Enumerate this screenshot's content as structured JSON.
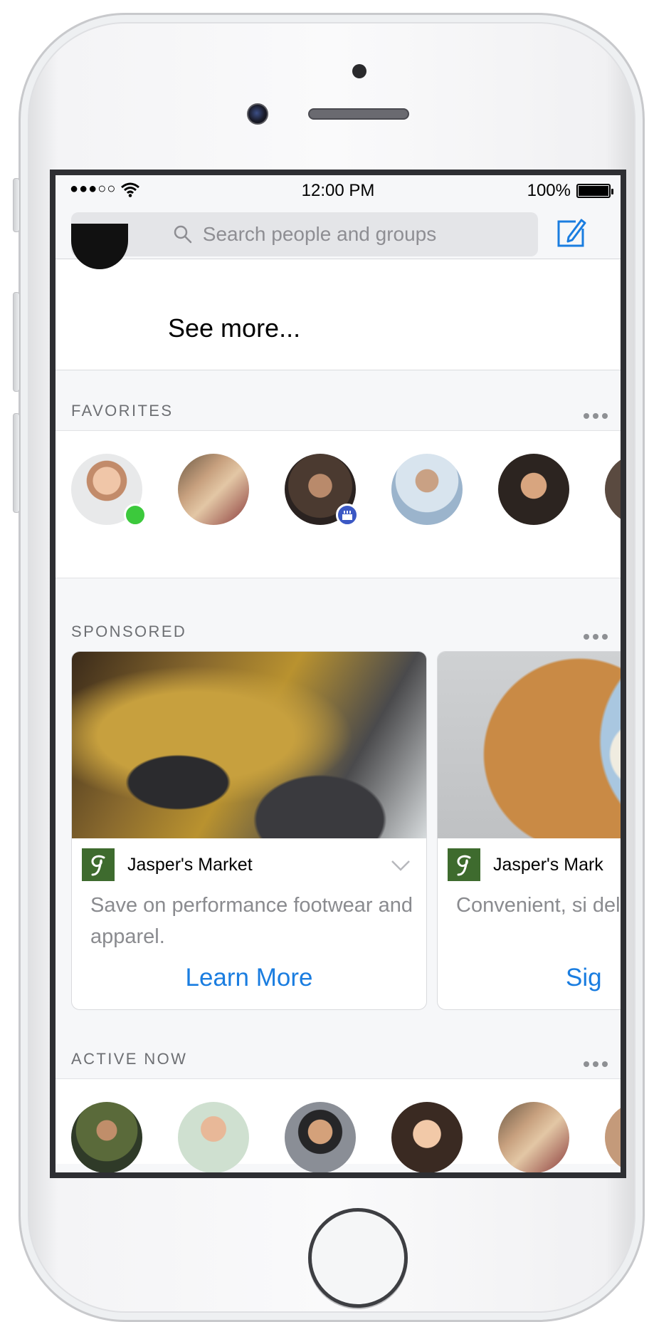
{
  "status_bar": {
    "signal": "●●●○○",
    "time": "12:00 PM",
    "battery": "100%"
  },
  "search": {
    "placeholder": "Search people and groups"
  },
  "see_more": "See more...",
  "favorites": {
    "title": "FAVORITES"
  },
  "sponsored": {
    "title": "SPONSORED",
    "ads": [
      {
        "brand": "Jasper's Market",
        "text": "Save on performance footwear and apparel.",
        "cta": "Learn More"
      },
      {
        "brand": "Jasper's Mark",
        "text": "Convenient, si delicious. A ne",
        "cta": "Sig"
      }
    ]
  },
  "active_now": {
    "title": "ACTIVE NOW"
  },
  "colors": {
    "accent": "#1a7de0",
    "presence": "#3cc93c",
    "brand_logo": "#3e6b2e"
  }
}
